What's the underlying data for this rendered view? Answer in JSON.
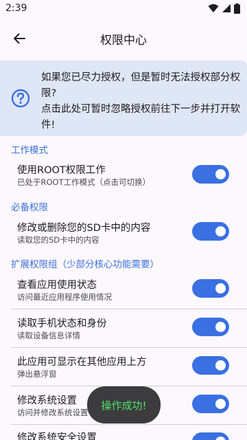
{
  "status_bar": {
    "time": "2:39"
  },
  "app_bar": {
    "title": "权限中心",
    "back_icon": "arrow-left-icon"
  },
  "notice": {
    "icon": "question-circle-icon",
    "line1": "如果您已尽力授权，但是暂时无法授权部分权",
    "line2": "限?",
    "line3": "点击此处可暂时忽略授权前往下一步并打开软",
    "line4": "件!"
  },
  "sections": [
    {
      "header": "工作模式",
      "items": [
        {
          "title": "使用ROOT权限工作",
          "subtitle": "已处于ROOT工作模式（点击可切换）",
          "enabled": true
        }
      ]
    },
    {
      "header": "必备权限",
      "items": [
        {
          "title": "修改或删除您的SD卡中的内容",
          "subtitle": "读取您的SD卡中的内容",
          "enabled": true
        }
      ]
    },
    {
      "header": "扩展权限组（少部分核心功能需要）",
      "items": [
        {
          "title": "查看应用使用状态",
          "subtitle": "访问最近应用程序使用情况",
          "enabled": true
        },
        {
          "title": "读取手机状态和身份",
          "subtitle": "读取设备信息详情",
          "enabled": true
        },
        {
          "title": "此应用可显示在其他应用上方",
          "subtitle": "弹出悬浮窗",
          "enabled": true
        },
        {
          "title": "修改系统设置",
          "subtitle": "访问并修改系统设置",
          "enabled": true
        },
        {
          "title": "修改系统安全设置",
          "subtitle": "",
          "enabled": true
        }
      ]
    }
  ],
  "toast": {
    "message": "操作成功!"
  },
  "colors": {
    "accent": "#3a70e2",
    "section_header": "#3d72d8",
    "card_bg": "#dfe6f5",
    "toast_text": "#4ee06a"
  }
}
